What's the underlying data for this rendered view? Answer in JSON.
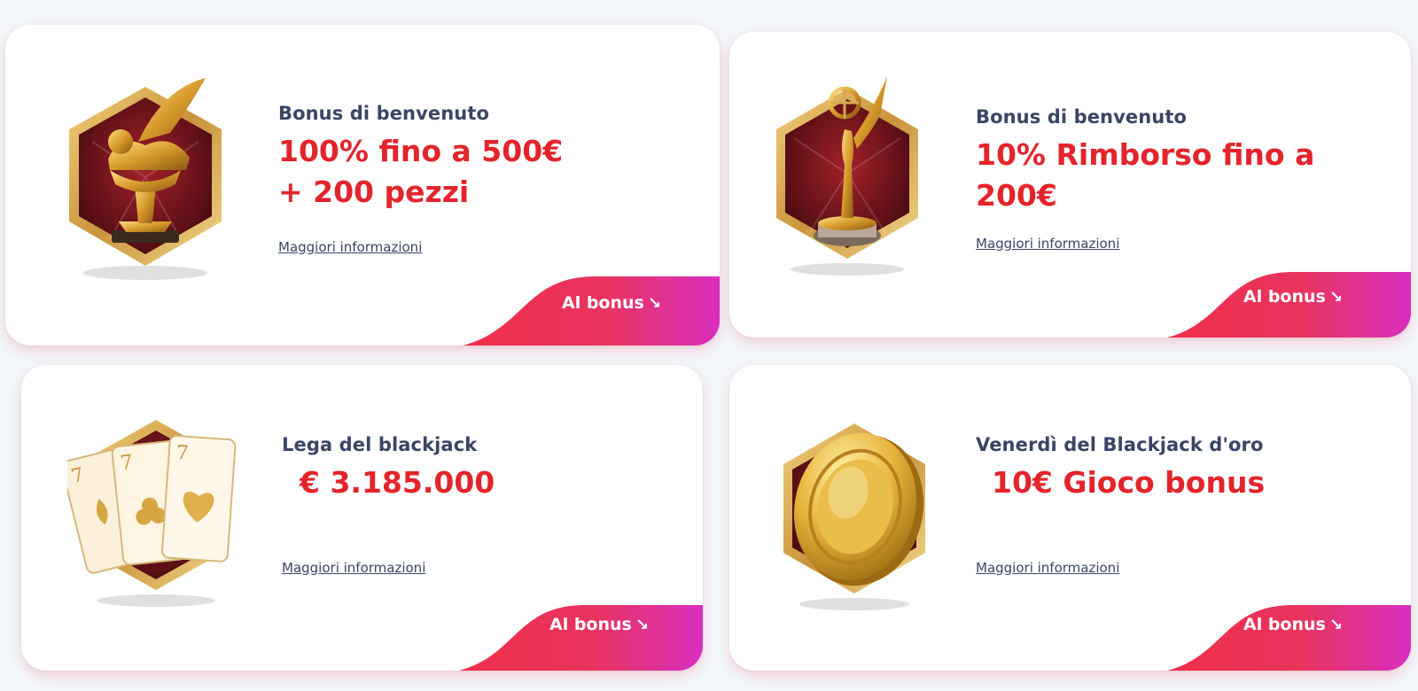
{
  "colors": {
    "accent_red": "#e3242b",
    "heading_navy": "#3a4566",
    "cta_gradient_start": "#ef2f4a",
    "cta_gradient_end": "#d92fc0",
    "emblem_frame_gold": "#d7a84a",
    "emblem_inner_dark": "#5e0f16"
  },
  "cards": [
    {
      "icon": "winged-lion-trophy-icon",
      "subtitle": "Bonus di benvenuto",
      "amount_line1": "100% fino a 500€",
      "amount_line2": "+ 200 pezzi",
      "more_link": "Maggiori informazioni",
      "cta": "Al bonus",
      "cta_arrow": "↘"
    },
    {
      "icon": "statuette-trophy-icon",
      "subtitle": "Bonus di benvenuto",
      "amount_line1": "10% Rimborso fino a",
      "amount_line2": "200€",
      "more_link": "Maggiori informazioni",
      "cta": "Al bonus",
      "cta_arrow": "↘"
    },
    {
      "icon": "playing-cards-sevens-icon",
      "subtitle": "Lega del blackjack",
      "amount_line1": "€ 3.185.000",
      "more_link": "Maggiori informazioni",
      "cta": "Al bonus",
      "cta_arrow": "↘"
    },
    {
      "icon": "gold-coin-icon",
      "subtitle": "Venerdì del Blackjack d'oro",
      "amount_line1": "10€ Gioco bonus",
      "more_link": "Maggiori informazioni",
      "cta": "Al bonus",
      "cta_arrow": "↘"
    }
  ]
}
